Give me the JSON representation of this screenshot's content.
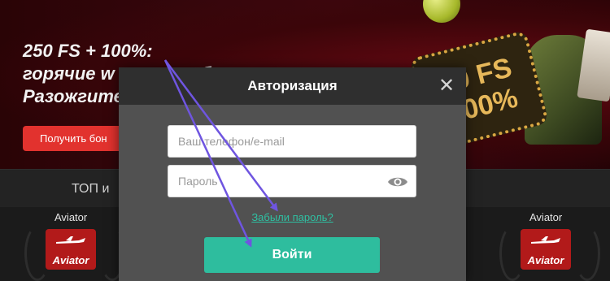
{
  "banner": {
    "promo_line_1": "250 FS + 100%:",
    "promo_line_2": "горячие w",
    "promo_line_2_tail": "б",
    "promo_line_3": "Разожгите",
    "bonus_button_label": "Получить бон",
    "art_text_line_1": "50 FS",
    "art_text_line_2": "100%"
  },
  "games": {
    "top_label_left": "ТОП и",
    "top_label_right": "",
    "items": [
      {
        "title": "Aviator",
        "logo_text": "Aviator"
      },
      {
        "title": "Aviator",
        "logo_text": "Aviator"
      }
    ]
  },
  "modal": {
    "title": "Авторизация",
    "close_symbol": "✕",
    "login_placeholder": "Ваш телефон/e-mail",
    "password_placeholder": "Пароль",
    "forgot_password_label": "Забыли пароль?",
    "login_button_label": "Войти"
  },
  "colors": {
    "accent": "#2ebd9e",
    "link": "#2fc0a2",
    "promo_button": "#e2322e",
    "annotation_arrow": "#6f55e0"
  },
  "icons": {
    "close": "close-icon",
    "password_visibility": "eye-icon"
  }
}
